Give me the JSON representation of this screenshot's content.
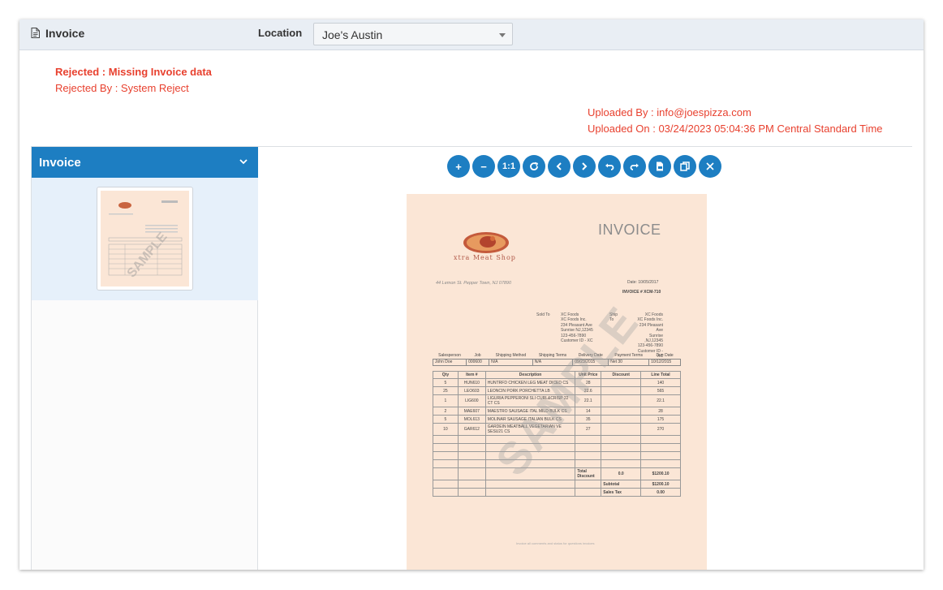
{
  "header": {
    "title": "Invoice",
    "location_label": "Location",
    "location_value": "Joe's Austin"
  },
  "status": {
    "rejected_reason": "Rejected : Missing Invoice data",
    "rejected_by": "Rejected By : System Reject",
    "uploaded_by": "Uploaded By : info@joespizza.com",
    "uploaded_on": "Uploaded On : 03/24/2023 05:04:36 PM Central Standard Time"
  },
  "sidebar": {
    "title": "Invoice"
  },
  "toolbar": {
    "zoom_in": "+",
    "zoom_out": "−",
    "actual_size": "1:1"
  },
  "document": {
    "title": "INVOICE",
    "shop_name": "xtra Meat Shop",
    "address": "44 Lemon St. Pepper Town, NJ 07890",
    "date": "Date: 10/05/2017",
    "invoice_no": "INVOICE # XCM-710",
    "watermark": "SAMPLE",
    "sold_to_label": "Sold To",
    "sold_to": [
      "XC Foods",
      "XC Foods Inc.",
      "234 Pleasant Ave",
      "Sunrise NJ,12345",
      "123-456-7890",
      "Customer ID - XC"
    ],
    "ship_to_label": [
      "Ship",
      "To"
    ],
    "ship_to": [
      "XC Foods",
      "XC Foods Inc.",
      "234 Pleasant Ave",
      "Sunrise ,NJ,12345",
      "123-456-7890",
      "Customer ID - XC"
    ],
    "meta_headers": [
      "Salesperson",
      "Job",
      "Shipping Method",
      "Shipping Terms",
      "Delivery Date",
      "Payment Terms",
      "Due Date"
    ],
    "meta_values": [
      "John Doe",
      "000600",
      "N/A",
      "N/A",
      "09/23/2015",
      "Net 30",
      "10/12/2015"
    ],
    "item_headers": [
      "Qty",
      "Item #",
      "Description",
      "Unit Price",
      "Discount",
      "Line Total"
    ],
    "items": [
      [
        "5",
        "HUN610",
        "HUNTRFD CHICKEN LEG MEAT DICED CS",
        "28",
        "",
        "140"
      ],
      [
        "25",
        "LEO603",
        "LEONCIN PORK PORCHETTA LB",
        "22.6",
        "",
        "565"
      ],
      [
        "1",
        "LIG600",
        "LIGURIA PEPPERONI SLI CURL&CRISP 22 CT CS",
        "22.1",
        "",
        "22.1"
      ],
      [
        "2",
        "MAE607",
        "MAESTRO SAUSAGE ITAL MILD BULK CS",
        "14",
        "",
        "28"
      ],
      [
        "5",
        "MOL613",
        "MOLINAR SAUSAGE ITALIAN BULK CS",
        "35",
        "",
        "175"
      ],
      [
        "10",
        "GAR612",
        "GARDEIN MEATBALL VEGETARIAN VE SESU21 CS",
        "27",
        "",
        "270"
      ]
    ],
    "total_discount_label": "Total Discount",
    "total_discount": "0.0",
    "total_discount_amount": "$1200.10",
    "subtotal_label": "Subtotal",
    "subtotal": "$1200.10",
    "sales_tax_label": "Sales Tax",
    "sales_tax": "0.00",
    "footer": "Invoice all comments and status for questions invoices"
  }
}
